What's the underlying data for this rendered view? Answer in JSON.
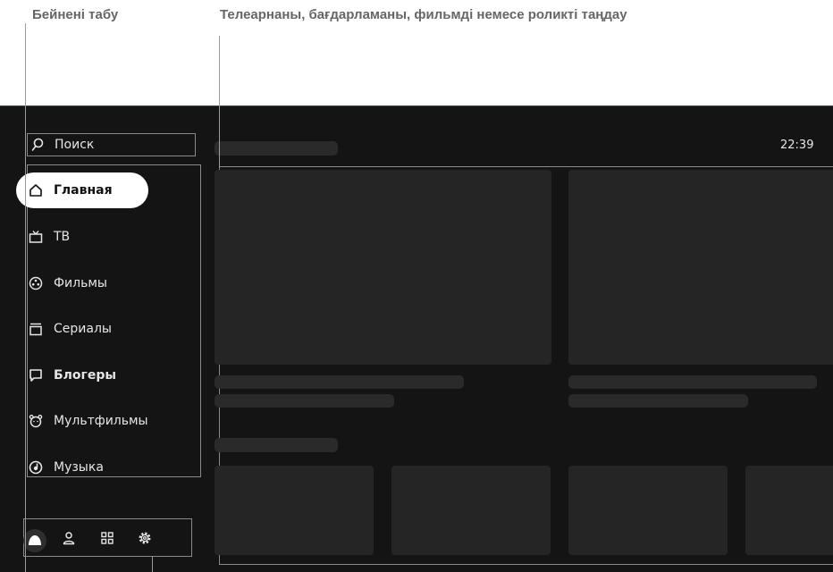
{
  "annotations": {
    "play_video_label": "Бейнені табу",
    "select_content_label": "Телеарнаны, бағдарламаны, фильмді немесе роликті таңдау"
  },
  "tv": {
    "search": {
      "label": "Поиск",
      "icon": "search-icon"
    },
    "clock": "22:39",
    "nav": [
      {
        "label": "Главная",
        "icon": "home-icon",
        "active": true
      },
      {
        "label": "ТВ",
        "icon": "tv-icon"
      },
      {
        "label": "Фильмы",
        "icon": "film-reel-icon"
      },
      {
        "label": "Сериалы",
        "icon": "series-icon"
      },
      {
        "label": "Блогеры",
        "icon": "chat-bubble-icon"
      },
      {
        "label": "Мультфильмы",
        "icon": "cartoon-bear-icon"
      },
      {
        "label": "Музыка",
        "icon": "music-icon"
      }
    ],
    "bottom_bar": [
      "alice-assistant-icon",
      "profile-icon",
      "apps-grid-icon",
      "settings-gear-icon"
    ],
    "colors": {
      "screen_bg": "#141414",
      "skeleton": "#262626",
      "active_pill": "#ffffff",
      "text": "#e6e6e6"
    }
  }
}
